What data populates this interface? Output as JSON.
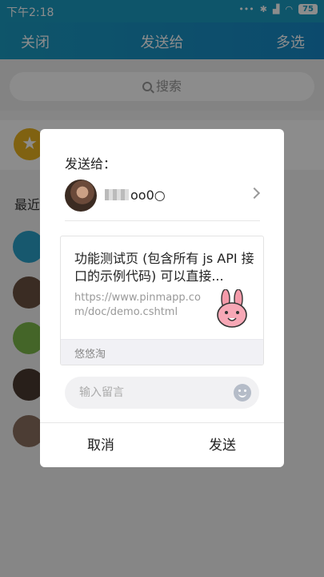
{
  "status_bar": {
    "time": "下午2:18",
    "signal": "•••",
    "battery": "75"
  },
  "nav": {
    "close_label": "关闭",
    "title": "发送给",
    "multi_select_label": "多选"
  },
  "search": {
    "placeholder": "搜索"
  },
  "list": {
    "recent_label": "最近"
  },
  "dialog": {
    "title": "发送给：",
    "recipient": {
      "name_visible": "oo0○"
    },
    "card": {
      "title": "功能测试页 (包含所有 js API 接口的示例代码) 可以直接...",
      "url": "https://www.pinmapp.com/doc/demo.cshtml",
      "source": "悠悠淘"
    },
    "message": {
      "placeholder": "输入留言"
    },
    "cancel_label": "取消",
    "send_label": "发送"
  },
  "colors": {
    "accent": "#1a9bc2",
    "star": "#e9b21f"
  }
}
